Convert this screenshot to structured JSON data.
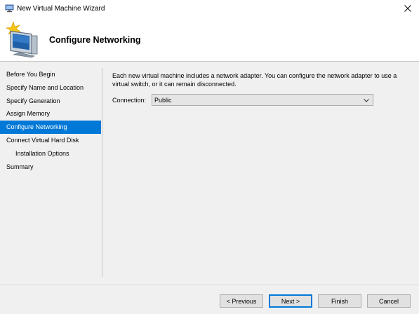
{
  "window": {
    "title": "New Virtual Machine Wizard",
    "close_glyph": "✕"
  },
  "header": {
    "title": "Configure Networking",
    "icon": "virtual-machine-wizard-icon"
  },
  "nav": {
    "items": [
      {
        "label": "Before You Begin",
        "active": false,
        "sub": false
      },
      {
        "label": "Specify Name and Location",
        "active": false,
        "sub": false
      },
      {
        "label": "Specify Generation",
        "active": false,
        "sub": false
      },
      {
        "label": "Assign Memory",
        "active": false,
        "sub": false
      },
      {
        "label": "Configure Networking",
        "active": true,
        "sub": false
      },
      {
        "label": "Connect Virtual Hard Disk",
        "active": false,
        "sub": false
      },
      {
        "label": "Installation Options",
        "active": false,
        "sub": true
      },
      {
        "label": "Summary",
        "active": false,
        "sub": false
      }
    ]
  },
  "main": {
    "description": "Each new virtual machine includes a network adapter. You can configure the network adapter to use a virtual switch, or it can remain disconnected.",
    "connection_label": "Connection:",
    "connection_value": "Public"
  },
  "buttons": {
    "previous": "< Previous",
    "next": "Next >",
    "finish": "Finish",
    "cancel": "Cancel"
  },
  "colors": {
    "accent": "#0078d7",
    "nav_active_text": "#ffffff"
  }
}
